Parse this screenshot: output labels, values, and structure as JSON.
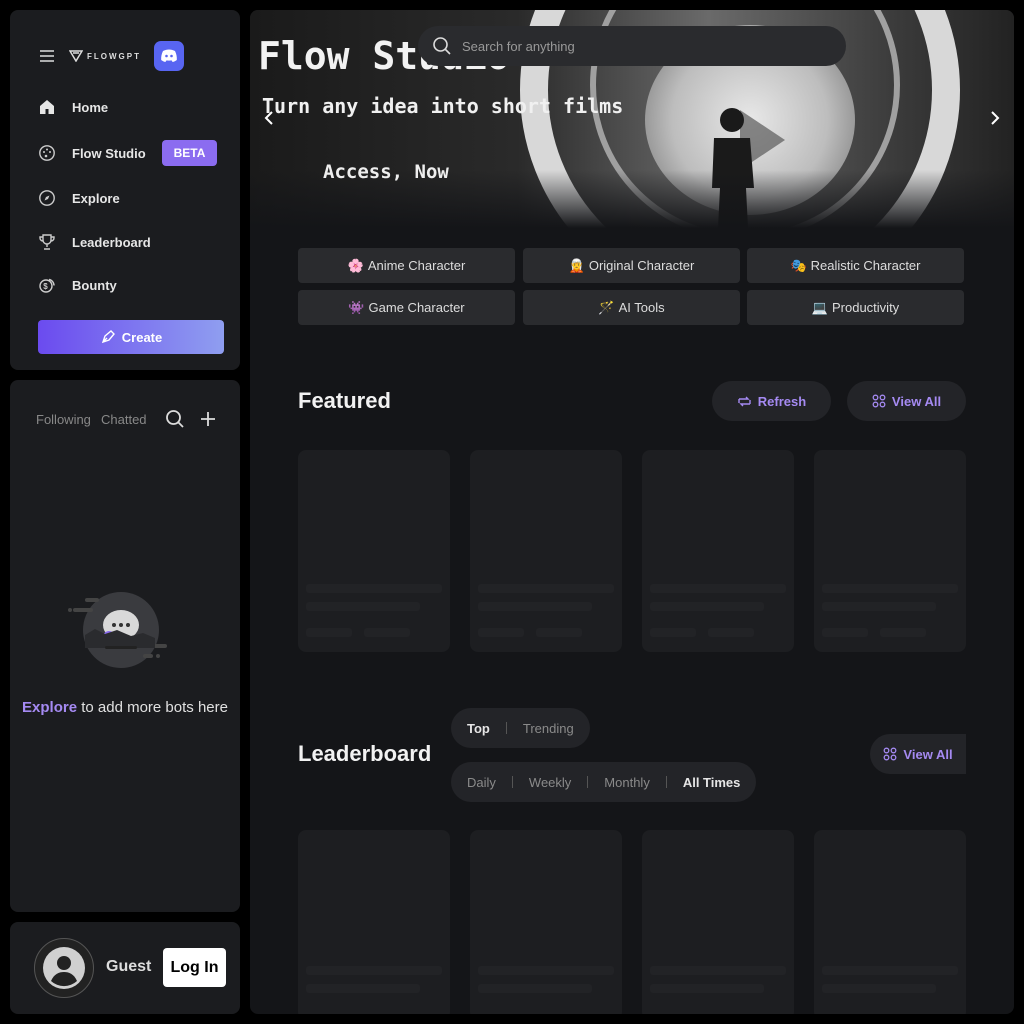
{
  "brand": {
    "logo_text": "FLOWGPT"
  },
  "nav": {
    "items": [
      {
        "label": "Home",
        "icon": "home-icon"
      },
      {
        "label": "Flow Studio",
        "icon": "palette-icon",
        "badge": "BETA"
      },
      {
        "label": "Explore",
        "icon": "compass-icon"
      },
      {
        "label": "Leaderboard",
        "icon": "trophy-icon"
      },
      {
        "label": "Bounty",
        "icon": "coins-icon"
      }
    ],
    "create_label": "Create"
  },
  "chats": {
    "tabs": [
      "Following",
      "Chatted"
    ],
    "empty_link": "Explore",
    "empty_text": " to add more bots here"
  },
  "account": {
    "name": "Guest",
    "login_label": "Log In"
  },
  "search": {
    "placeholder": "Search for anything"
  },
  "hero": {
    "title": "Flow Studio",
    "subtitle": "Turn any idea into short films",
    "cta": "Access, Now"
  },
  "categories": [
    {
      "emoji": "🌸",
      "label": "Anime Character"
    },
    {
      "emoji": "🧝",
      "label": "Original Character"
    },
    {
      "emoji": "🎭",
      "label": "Realistic Character"
    },
    {
      "emoji": "👾",
      "label": "Game Character"
    },
    {
      "emoji": "🪄",
      "label": "AI Tools"
    },
    {
      "emoji": "💻",
      "label": "Productivity"
    }
  ],
  "featured": {
    "title": "Featured",
    "refresh_label": "Refresh",
    "view_all_label": "View All"
  },
  "leaderboard": {
    "title": "Leaderboard",
    "mode_tabs": [
      "Top",
      "Trending"
    ],
    "mode_selected": "Top",
    "period_tabs": [
      "Daily",
      "Weekly",
      "Monthly",
      "All Times"
    ],
    "period_selected": "All Times",
    "view_all_label": "View All"
  },
  "colors": {
    "accent": "#a58af2",
    "discord": "#5865f2",
    "beta": "#8b6cf0"
  }
}
